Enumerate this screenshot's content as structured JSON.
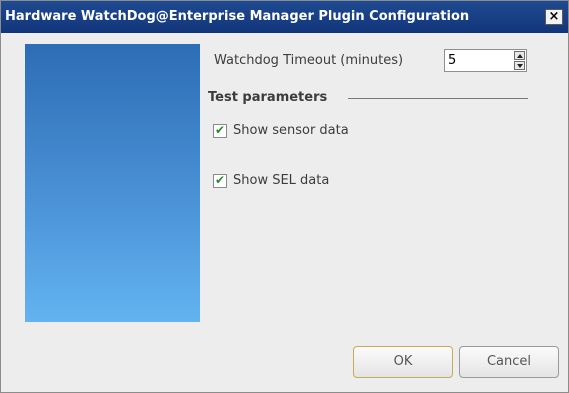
{
  "window": {
    "title": "Hardware WatchDog@Enterprise Manager Plugin Configuration",
    "close_glyph": "×",
    "close_icon": "close-icon"
  },
  "settings": {
    "timeout_label": "Watchdog Timeout (minutes)",
    "timeout_value": "5"
  },
  "test_parameters": {
    "title": "Test parameters",
    "options": [
      {
        "label": "Show sensor data",
        "checked": true
      },
      {
        "label": "Show SEL data",
        "checked": true
      }
    ]
  },
  "buttons": {
    "ok": "OK",
    "cancel": "Cancel"
  },
  "colors": {
    "titlebar": "#1f4a91",
    "side_panel_top": "#2d6db5",
    "side_panel_bottom": "#63b3f0",
    "checkmark": "#2a8a2a",
    "ok_border": "#c9a95a"
  }
}
